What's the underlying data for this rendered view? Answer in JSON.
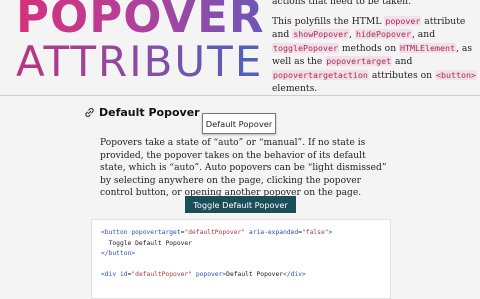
{
  "header": {
    "logo_line1": "POPOVER",
    "logo_line2": "ATTRIBUTE",
    "top_fragment": "actions that need to be taken.",
    "intro": {
      "t1": "This polyfills the HTML ",
      "c1": "popover",
      "t2": " attribute and ",
      "c2": "showPopover",
      "t3": ", ",
      "c3": "hidePopover",
      "t4": ", and ",
      "c4": "togglePopover",
      "t5": " methods on ",
      "c5": "HTMLElement",
      "t6": ", as well as the ",
      "c6": "popovertarget",
      "t7": " and ",
      "c7": "popovertargetaction",
      "t8": " attributes on ",
      "c8": "<button>",
      "t9": " elements."
    }
  },
  "section": {
    "icon": "link-icon",
    "heading": "Default Popover",
    "popover_text": "Default Popover",
    "description": "Popovers take a state of “auto” or “manual”. If no state is provided, the popover takes on the behavior of its default state, which is “auto”. Auto popovers can be “light dismissed” by selecting anywhere on the page, clicking the popover control button, or opening another popover on the page.",
    "toggle_button": "Toggle Default Popover"
  },
  "code": {
    "l1_open": "<button ",
    "l1_attr1": "popovertarget",
    "l1_eq1": "=",
    "l1_val1": "\"defaultPopover\"",
    "l1_attr2": " aria-expanded",
    "l1_eq2": "=",
    "l1_val2": "\"false\"",
    "l1_close": ">",
    "l2": "  Toggle Default Popover",
    "l3": "</button>",
    "l5_open": "<div ",
    "l5_attr1": "id",
    "l5_eq1": "=",
    "l5_val1": "\"defaultPopover\"",
    "l5_attr2": " popover",
    "l5_close": ">",
    "l5_text": "Default Popover",
    "l5_end": "</div>"
  },
  "colors": {
    "accent": "#1c4e5a",
    "code_inline": "#b0265a",
    "logo_start": "#d6317c",
    "logo_end": "#4a63bd"
  }
}
